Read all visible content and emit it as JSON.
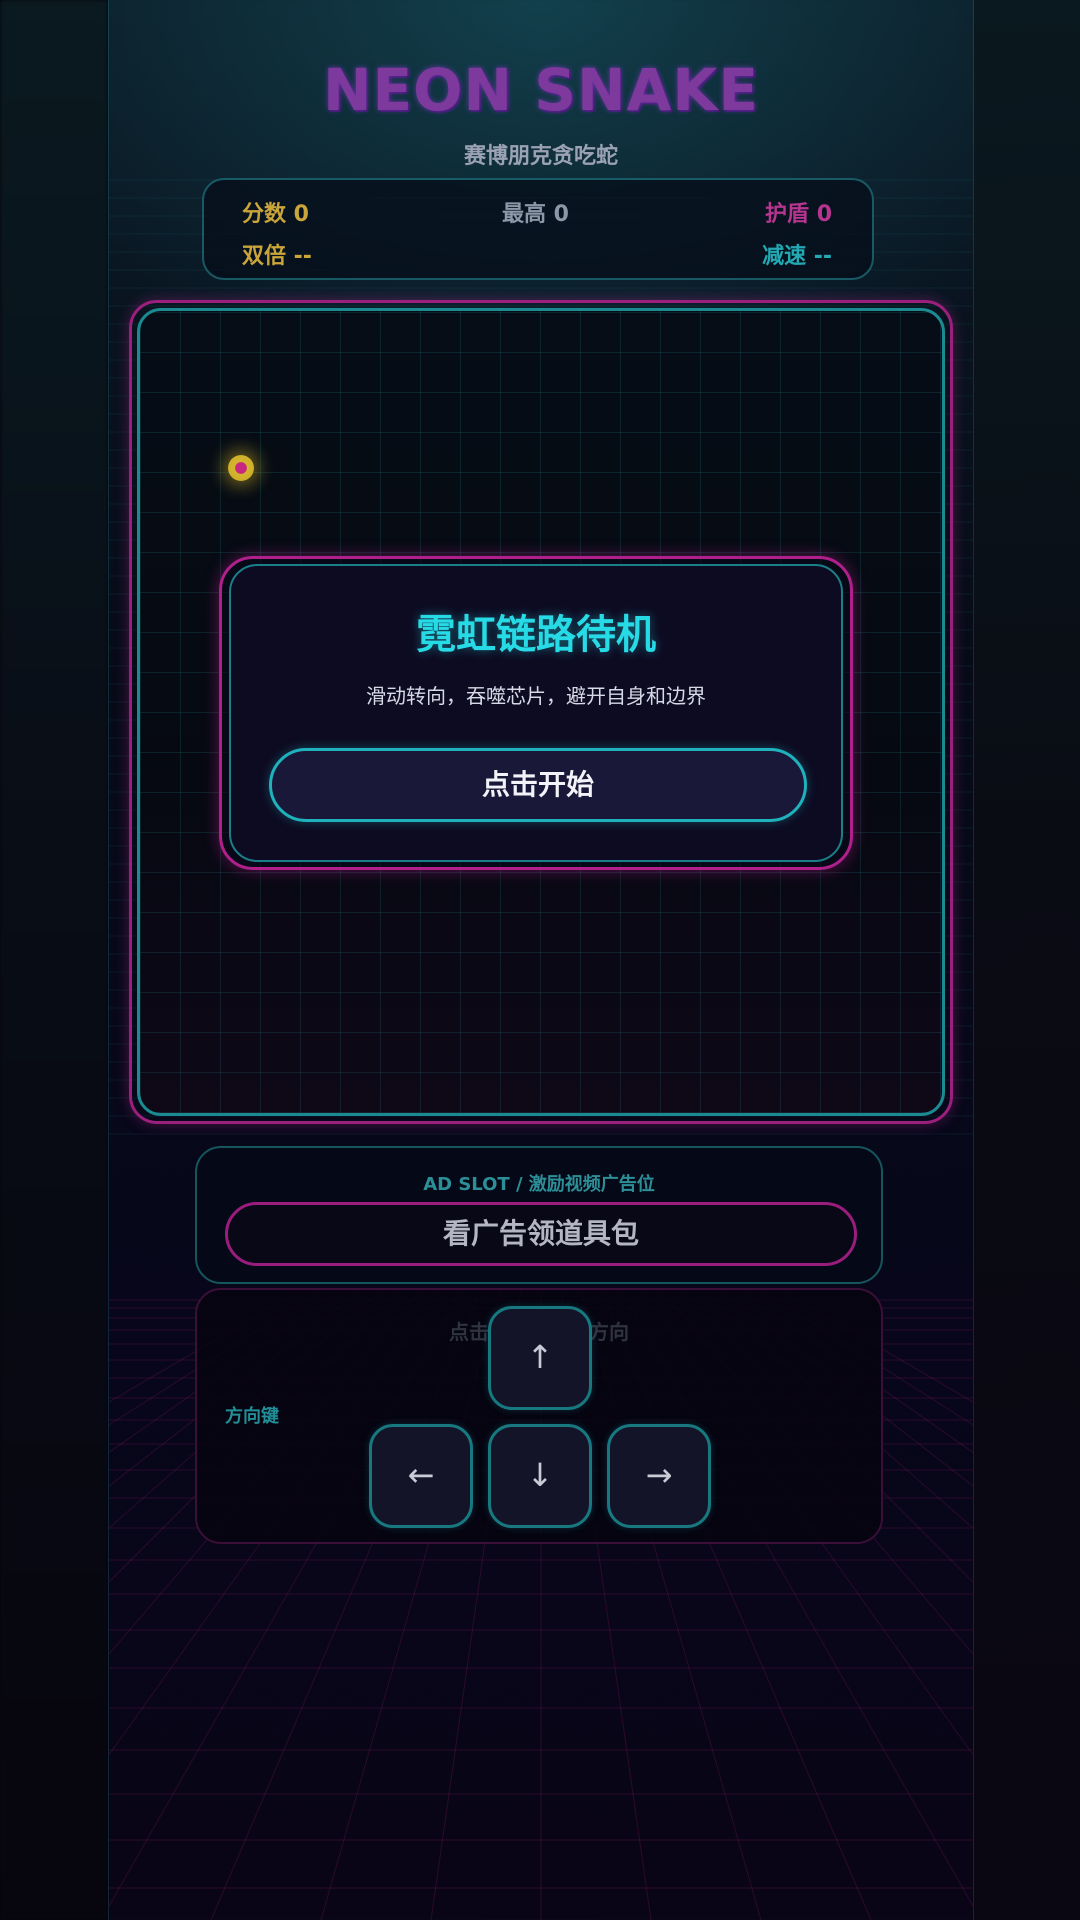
{
  "header": {
    "title": "NEON SNAKE",
    "subtitle": "赛博朋克贪吃蛇"
  },
  "hud": {
    "score": "分数 0",
    "best": "最高 0",
    "shield": "护盾 0",
    "double": "双倍 --",
    "slow": "减速 --"
  },
  "board": {
    "food_icon": "chip-icon"
  },
  "modal": {
    "title": "霓虹链路待机",
    "hint": "滑动转向，吞噬芯片，避开自身和边界",
    "start_label": "点击开始"
  },
  "ad": {
    "label": "AD SLOT / 激励视频广告位",
    "button_label": "看广告领道具包"
  },
  "controls": {
    "hint": "点击开始后控制方向",
    "label": "方向键",
    "up": "↑",
    "left": "←",
    "down": "↓",
    "right": "→"
  },
  "colors": {
    "accent_cyan": "#27dbe6",
    "accent_magenta": "#b0208b",
    "gold": "#c9a53a"
  }
}
